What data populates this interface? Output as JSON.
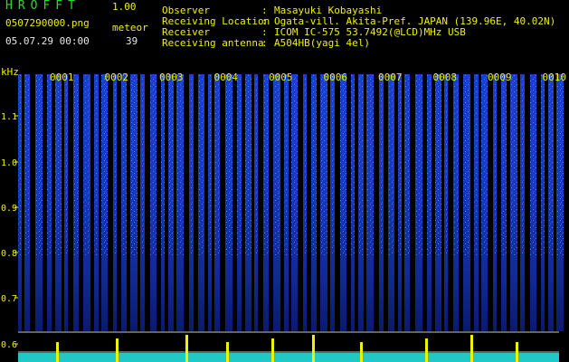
{
  "header": {
    "app_title": "HROFFT",
    "app_version": "1.00",
    "file_name": "0507290000.png",
    "meteor_label": "meteor",
    "datetime": "05.07.29 00:00",
    "meteor_count": "39"
  },
  "station_info": [
    {
      "key": "Observer",
      "value": "Masayuki Kobayashi"
    },
    {
      "key": "Receiving Location",
      "value": "Ogata-vill. Akita-Pref. JAPAN (139.96E, 40.02N)"
    },
    {
      "key": "Receiver",
      "value": "ICOM IC-575 53.7492(@LCD)MHz USB"
    },
    {
      "key": "Receiving antenna",
      "value": "A504HB(yagi 4el)"
    }
  ],
  "spectrogram": {
    "y_axis_unit": "kHz",
    "y_ticks": [
      "1.1",
      "1.0",
      "0.9",
      "0.8",
      "0.7",
      "0.6"
    ],
    "segment_labels": [
      "0001",
      "0002",
      "0003",
      "0004",
      "0005",
      "0006",
      "0007",
      "0008",
      "0009",
      "0010"
    ],
    "colors": {
      "background": "#000000",
      "noise_low": "#0a1a6e",
      "noise_mid": "#1a3fd0",
      "noise_high": "#20c8c8",
      "peak": "#f0f000",
      "grid": "#c8c8c8"
    }
  }
}
